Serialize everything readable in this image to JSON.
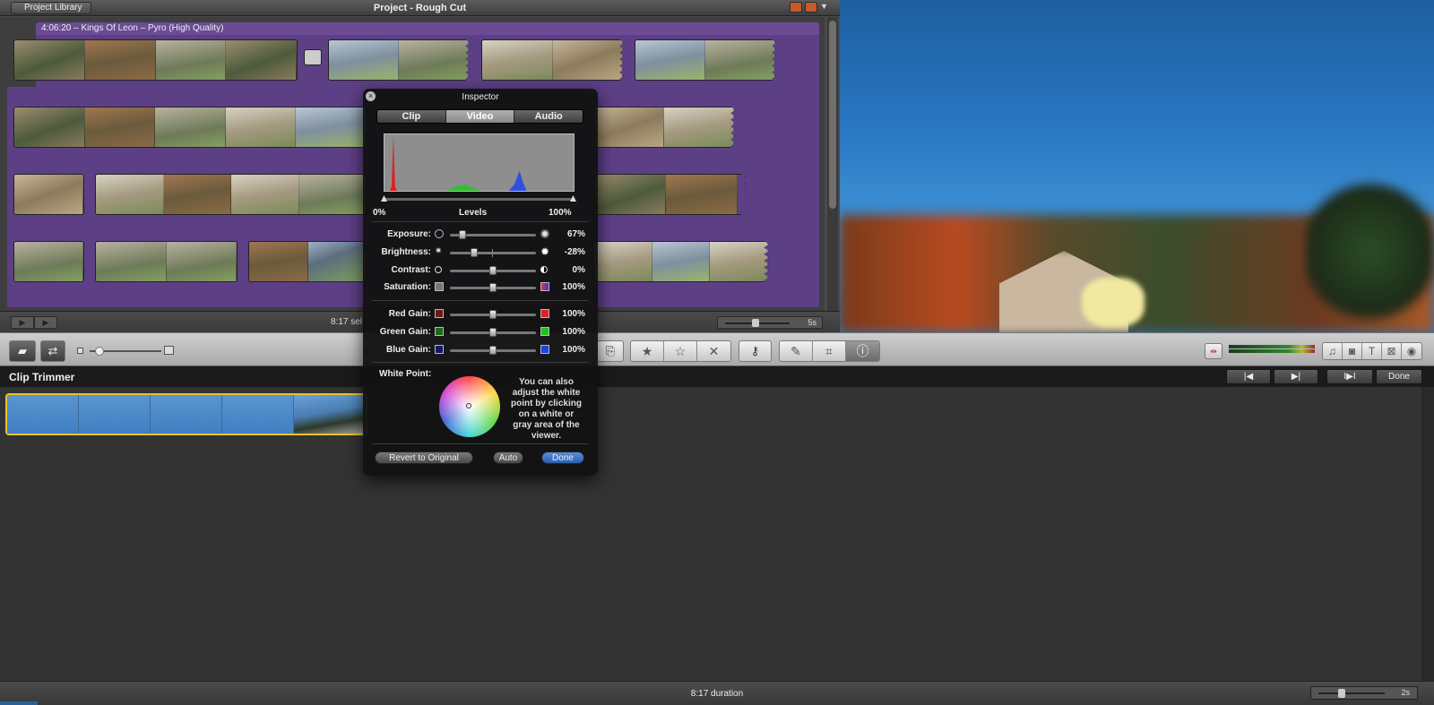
{
  "project": {
    "library_button": "Project Library",
    "title": "Project - Rough Cut",
    "music_track": "4:06:20 – Kings Of Leon – Pyro (High Quality)",
    "status": "8:17 sel",
    "zoom_value": "5s"
  },
  "toolbar": {
    "icons": [
      "camera-import-icon",
      "swap-icon",
      "thumbnail-size-slider",
      "audio-adjust-icon",
      "favorite-icon",
      "unfavorite-icon",
      "reject-icon",
      "keyword-icon",
      "eyedropper-icon",
      "crop-icon",
      "inspector-icon",
      "audio-meter",
      "music-icon",
      "photo-icon",
      "title-icon",
      "transition-icon",
      "map-icon"
    ]
  },
  "trimmer": {
    "title": "Clip Trimmer",
    "done_label": "Done"
  },
  "bottom": {
    "status": "8:17 duration",
    "zoom_value": "2s"
  },
  "inspector": {
    "title": "Inspector",
    "tabs": [
      "Clip",
      "Video",
      "Audio"
    ],
    "active_tab": "Video",
    "levels_label": "Levels",
    "levels_min": "0%",
    "levels_max": "100%",
    "sliders": [
      {
        "label": "Exposure:",
        "value": "67%",
        "level": 0.15
      },
      {
        "label": "Brightness:",
        "value": "-28%",
        "level": 0.28
      },
      {
        "label": "Contrast:",
        "value": "0%",
        "level": 0.5
      },
      {
        "label": "Saturation:",
        "value": "100%",
        "level": 0.5
      },
      {
        "label": "Red Gain:",
        "value": "100%",
        "level": 0.5
      },
      {
        "label": "Green Gain:",
        "value": "100%",
        "level": 0.5
      },
      {
        "label": "Blue Gain:",
        "value": "100%",
        "level": 0.5
      }
    ],
    "white_point_label": "White Point:",
    "white_point_help": "You can also adjust the white point by clicking on a white or gray area of the viewer.",
    "revert_label": "Revert to Original",
    "auto_label": "Auto",
    "done_label": "Done"
  },
  "colors": {
    "purple": "#5d3f86",
    "trim_border": "#e8c42a",
    "done_blue": "#2a5fb0"
  }
}
